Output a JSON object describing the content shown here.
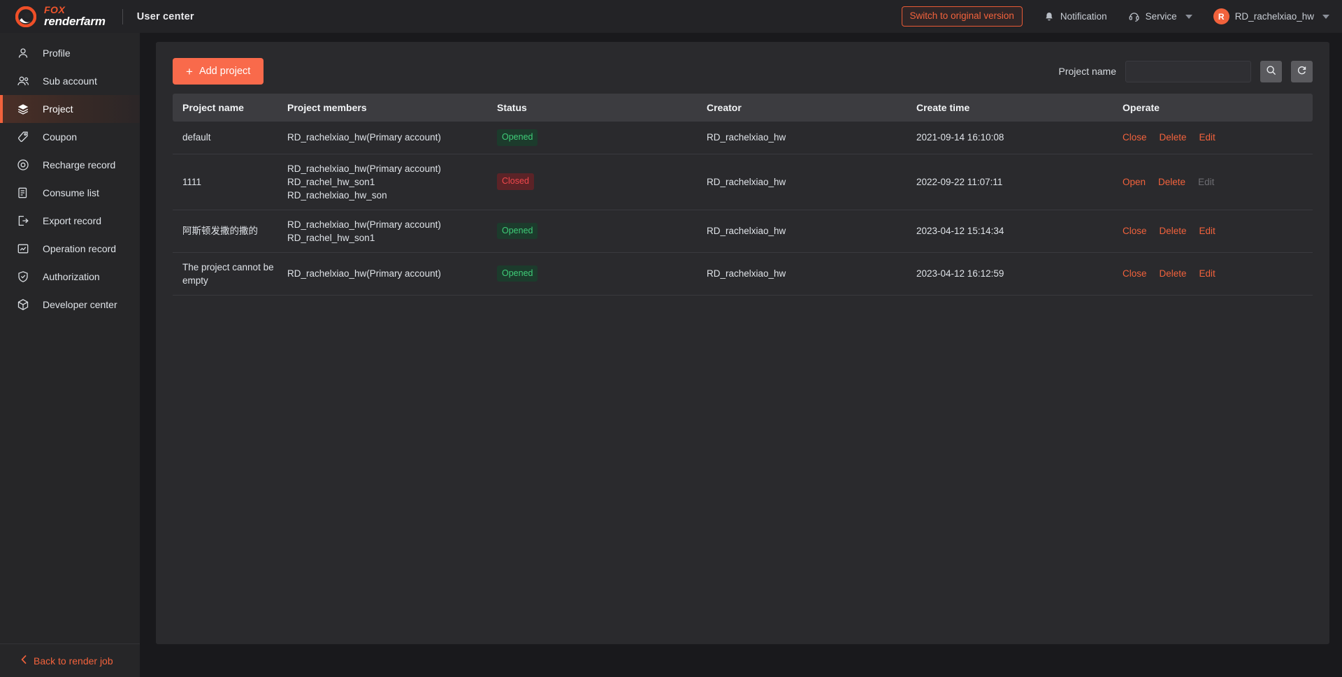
{
  "header": {
    "logo_top": "FOX",
    "logo_bottom": "renderfarm",
    "logo_icon": "fox-renderfarm-logo",
    "title": "User center",
    "switch_label": "Switch to original version",
    "notification_label": "Notification",
    "notification_icon": "bell-icon",
    "service_label": "Service",
    "service_icon": "headset-icon",
    "user_initial": "R",
    "user_name": "RD_rachelxiao_hw"
  },
  "sidebar": {
    "items": [
      {
        "label": "Profile",
        "icon": "user-icon",
        "active": false
      },
      {
        "label": "Sub account",
        "icon": "users-icon",
        "active": false
      },
      {
        "label": "Project",
        "icon": "layers-icon",
        "active": true
      },
      {
        "label": "Coupon",
        "icon": "tag-icon",
        "active": false
      },
      {
        "label": "Recharge record",
        "icon": "target-circle-icon",
        "active": false
      },
      {
        "label": "Consume list",
        "icon": "list-document-icon",
        "active": false
      },
      {
        "label": "Export record",
        "icon": "export-arrow-icon",
        "active": false
      },
      {
        "label": "Operation record",
        "icon": "monitor-chart-icon",
        "active": false
      },
      {
        "label": "Authorization",
        "icon": "shield-check-icon",
        "active": false
      },
      {
        "label": "Developer center",
        "icon": "cube-icon",
        "active": false
      }
    ],
    "footer": {
      "label": "Back to render job",
      "icon": "chevron-left-icon"
    }
  },
  "toolbar": {
    "add_label": "Add project",
    "add_icon": "plus-icon",
    "filter_label": "Project name",
    "filter_value": "",
    "filter_placeholder": "",
    "search_icon": "search-icon",
    "refresh_icon": "refresh-icon"
  },
  "table": {
    "columns": [
      "Project name",
      "Project members",
      "Status",
      "Creator",
      "Create time",
      "Operate"
    ],
    "rows": [
      {
        "name": "default",
        "members": [
          "RD_rachelxiao_hw(Primary account)"
        ],
        "status": "Opened",
        "status_kind": "opened",
        "creator": "RD_rachelxiao_hw",
        "create_time": "2021-09-14 16:10:08",
        "ops": [
          {
            "label": "Close",
            "disabled": false
          },
          {
            "label": "Delete",
            "disabled": false
          },
          {
            "label": "Edit",
            "disabled": false
          }
        ]
      },
      {
        "name": "1111",
        "members": [
          "RD_rachelxiao_hw(Primary account)",
          "RD_rachel_hw_son1",
          "RD_rachelxiao_hw_son"
        ],
        "status": "Closed",
        "status_kind": "closed",
        "creator": "RD_rachelxiao_hw",
        "create_time": "2022-09-22 11:07:11",
        "ops": [
          {
            "label": "Open",
            "disabled": false
          },
          {
            "label": "Delete",
            "disabled": false
          },
          {
            "label": "Edit",
            "disabled": true
          }
        ]
      },
      {
        "name": "阿斯顿发撒的撒的",
        "members": [
          "RD_rachelxiao_hw(Primary account)",
          "RD_rachel_hw_son1"
        ],
        "status": "Opened",
        "status_kind": "opened",
        "creator": "RD_rachelxiao_hw",
        "create_time": "2023-04-12 15:14:34",
        "ops": [
          {
            "label": "Close",
            "disabled": false
          },
          {
            "label": "Delete",
            "disabled": false
          },
          {
            "label": "Edit",
            "disabled": false
          }
        ]
      },
      {
        "name": "The project cannot be empty",
        "members": [
          "RD_rachelxiao_hw(Primary account)"
        ],
        "status": "Opened",
        "status_kind": "opened",
        "creator": "RD_rachelxiao_hw",
        "create_time": "2023-04-12 16:12:59",
        "ops": [
          {
            "label": "Close",
            "disabled": false
          },
          {
            "label": "Delete",
            "disabled": false
          },
          {
            "label": "Edit",
            "disabled": false
          }
        ]
      }
    ]
  },
  "colors": {
    "accent": "#f2623c",
    "add_button": "#f96a4b",
    "opened_text": "#3fcc78",
    "opened_bg": "#1c3b2c",
    "closed_text": "#f0484c",
    "closed_bg": "#5b2327",
    "page_bg": "#19191c",
    "panel_bg": "#2a2a2d",
    "sidebar_bg": "#262628",
    "header_bg": "#232326"
  }
}
